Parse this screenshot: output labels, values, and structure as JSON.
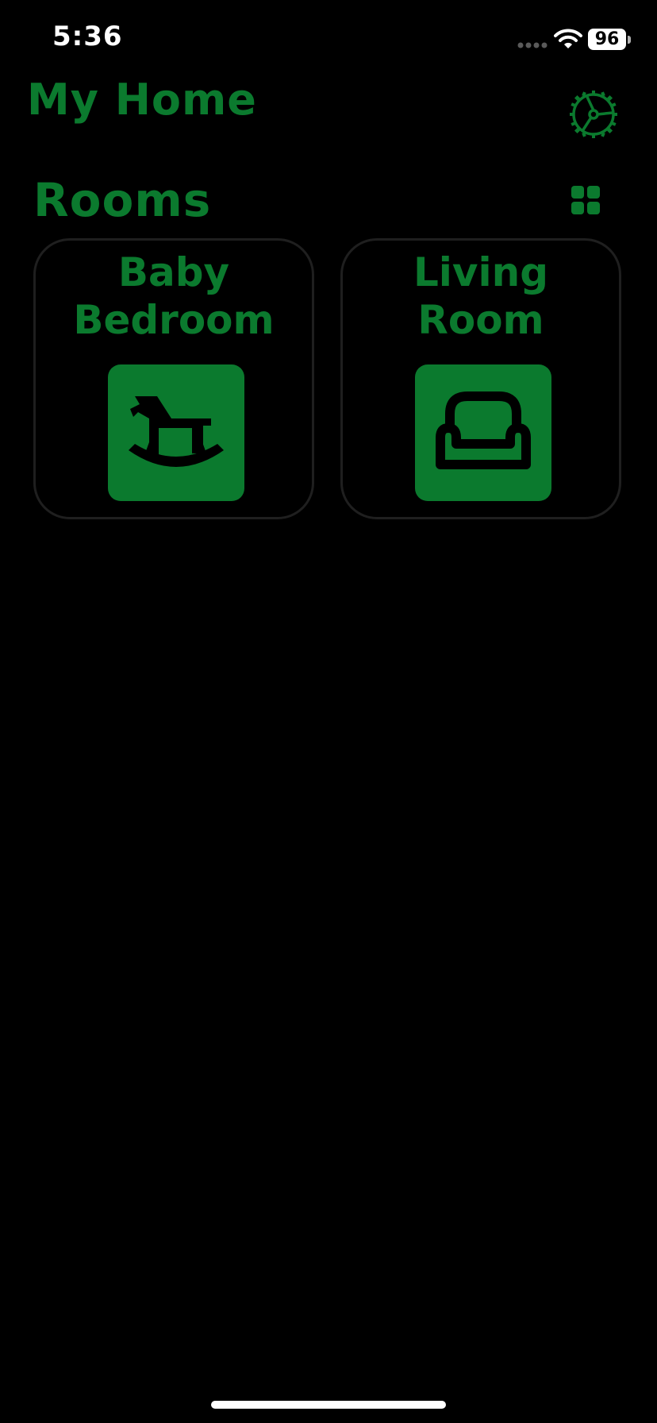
{
  "status_bar": {
    "time": "5:36",
    "battery": "96",
    "signal_icon": "cellular-dots-icon",
    "wifi_icon": "wifi-icon"
  },
  "header": {
    "title": "My Home",
    "settings_icon": "gear-icon"
  },
  "rooms_section": {
    "title": "Rooms",
    "layout_icon": "grid-icon"
  },
  "rooms": [
    {
      "name": "Baby\nBedroom",
      "icon": "rocking-horse-icon"
    },
    {
      "name": "Living\nRoom",
      "icon": "armchair-icon"
    }
  ],
  "colors": {
    "accent": "#0b7a2e",
    "background": "#000000",
    "card_border": "#1f1f1f"
  }
}
